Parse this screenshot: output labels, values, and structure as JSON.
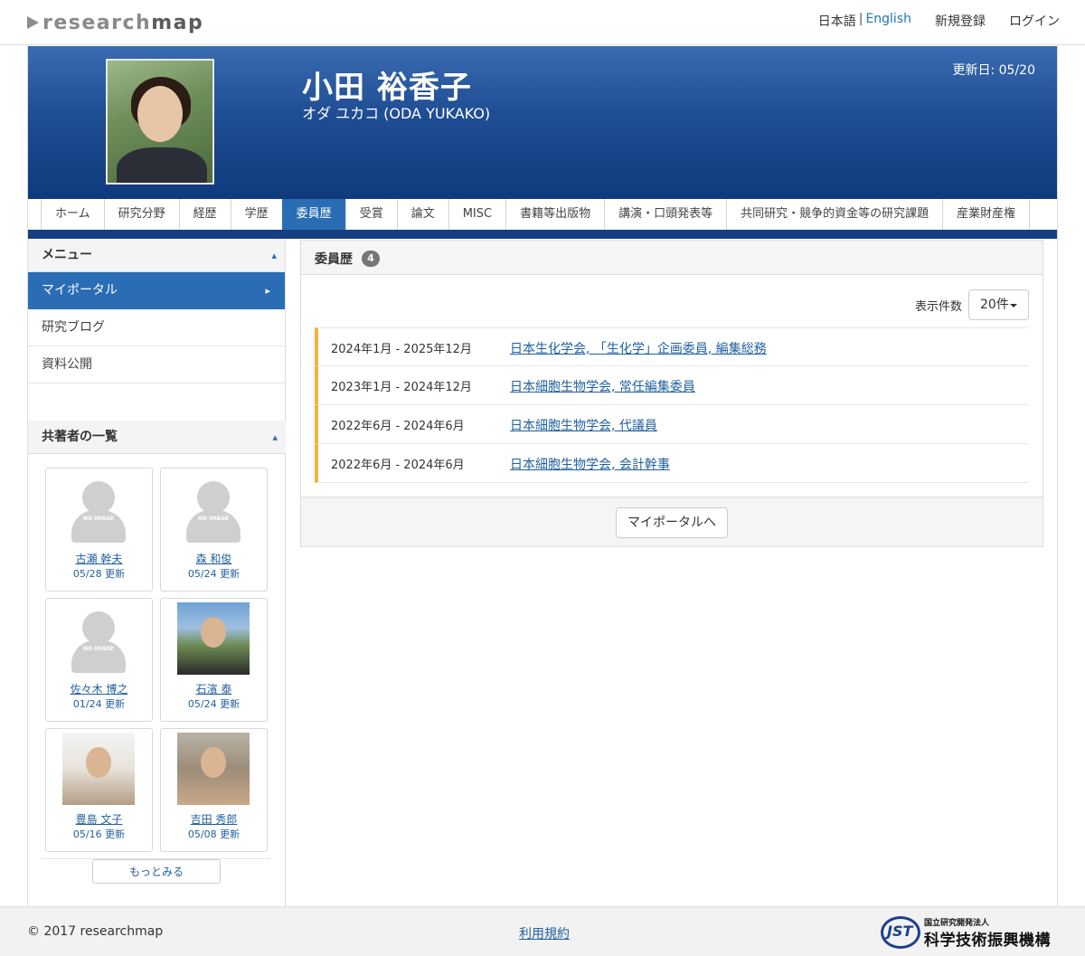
{
  "header": {
    "logo_research": "research",
    "logo_map": "map",
    "lang_ja": "日本語",
    "lang_sep": "|",
    "lang_en": "English",
    "register": "新規登録",
    "login": "ログイン"
  },
  "profile": {
    "name": "小田 裕香子",
    "kana": "オダ ユカコ  (ODA YUKAKO)",
    "updated": "更新日: 05/20"
  },
  "tabs": [
    {
      "label": "ホーム",
      "active": false
    },
    {
      "label": "研究分野",
      "active": false
    },
    {
      "label": "経歴",
      "active": false
    },
    {
      "label": "学歴",
      "active": false
    },
    {
      "label": "委員歴",
      "active": true
    },
    {
      "label": "受賞",
      "active": false
    },
    {
      "label": "論文",
      "active": false
    },
    {
      "label": "MISC",
      "active": false
    },
    {
      "label": "書籍等出版物",
      "active": false
    },
    {
      "label": "講演・口頭発表等",
      "active": false
    },
    {
      "label": "共同研究・競争的資金等の研究課題",
      "active": false
    },
    {
      "label": "産業財産権",
      "active": false
    }
  ],
  "sidebar": {
    "menu_title": "メニュー",
    "menu_items": [
      {
        "label": "マイポータル",
        "active": true
      },
      {
        "label": "研究ブログ",
        "active": false
      },
      {
        "label": "資料公開",
        "active": false
      }
    ],
    "coauthors_title": "共著者の一覧",
    "coauthors": [
      {
        "name": "古瀬 幹夫",
        "date": "05/28 更新",
        "image": "no-image"
      },
      {
        "name": "森 和俊",
        "date": "05/24 更新",
        "image": "no-image"
      },
      {
        "name": "佐々木 博之",
        "date": "01/24 更新",
        "image": "no-image"
      },
      {
        "name": "石濱 泰",
        "date": "05/24 更新",
        "image": "photo"
      },
      {
        "name": "豊島 文子",
        "date": "05/16 更新",
        "image": "photo"
      },
      {
        "name": "吉田 秀郎",
        "date": "05/08 更新",
        "image": "photo"
      }
    ],
    "no_image_text": "NO IMAGE",
    "more_label": "もっとみる"
  },
  "main": {
    "title": "委員歴",
    "count": "4",
    "per_page_label": "表示件数",
    "per_page_value": "20件",
    "entries": [
      {
        "date": "2024年1月 - 2025年12月",
        "title": "日本生化学会, 「生化学」企画委員, 編集総務"
      },
      {
        "date": "2023年1月 - 2024年12月",
        "title": "日本細胞生物学会, 常任編集委員"
      },
      {
        "date": "2022年6月 - 2024年6月",
        "title": "日本細胞生物学会, 代議員"
      },
      {
        "date": "2022年6月 - 2024年6月",
        "title": "日本細胞生物学会, 会計幹事"
      }
    ],
    "portal_button": "マイポータルへ"
  },
  "footer": {
    "copyright": "2017 researchmap",
    "terms": "利用規約",
    "jst_abbr": "JST",
    "jst_sub": "国立研究開発法人",
    "jst_main": "科学技術振興機構"
  },
  "colors": {
    "banner_dark": "#0f3a7d",
    "accent_blue": "#2a6db5",
    "row_accent": "#f0b43c",
    "link": "#1f5f9f"
  }
}
